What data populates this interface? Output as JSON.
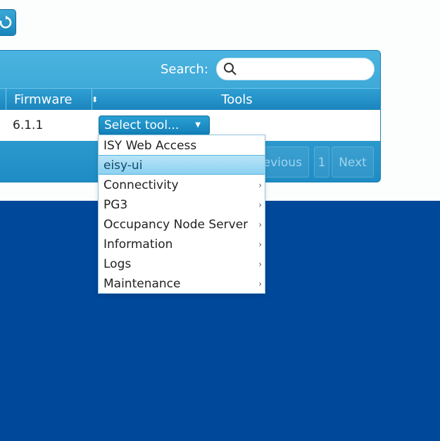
{
  "search": {
    "label": "Search:",
    "placeholder": ""
  },
  "table": {
    "headers": {
      "firmware": "Firmware",
      "tools": "Tools"
    },
    "row": {
      "firmware": "6.1.1",
      "tool_select_label": "Select tool..."
    }
  },
  "pager": {
    "previous": "Previous",
    "page": "1",
    "next": "Next"
  },
  "tool_menu": {
    "items": [
      {
        "label": "ISY Web Access",
        "submenu": false
      },
      {
        "label": "eisy-ui",
        "submenu": false,
        "highlighted": true
      },
      {
        "label": "Connectivity",
        "submenu": true
      },
      {
        "label": "PG3",
        "submenu": true
      },
      {
        "label": "Occupancy Node Server",
        "submenu": true
      },
      {
        "label": "Information",
        "submenu": true
      },
      {
        "label": "Logs",
        "submenu": true
      },
      {
        "label": "Maintenance",
        "submenu": true
      }
    ]
  },
  "colors": {
    "accent": "#1e8cc4",
    "background_lower": "#00489a",
    "highlight": "#8cd1f1"
  },
  "icons": {
    "refresh": "refresh-icon",
    "search": "search-icon",
    "sort": "sort-icon",
    "dropdown": "caret-down-icon",
    "submenu": "chevron-right-icon"
  }
}
